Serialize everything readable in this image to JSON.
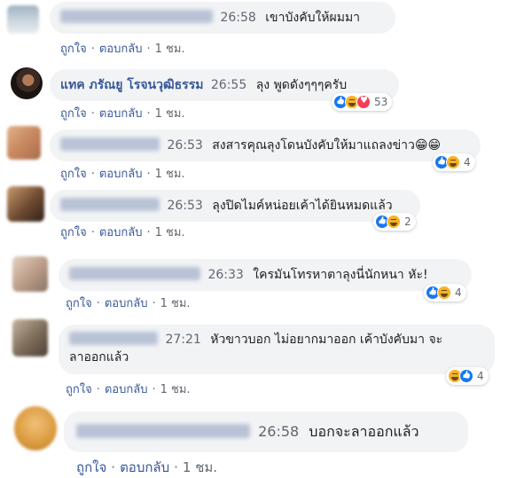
{
  "comments": [
    {
      "author": "",
      "time": "26:58",
      "text": "เขาบังคับให้ผมมา",
      "actions": {
        "like": "ถูกใจ",
        "reply": "ตอบกลับ",
        "ago": "1 ชม."
      },
      "reaction_count": "",
      "reactions": []
    },
    {
      "author": "แทค ภรัณยู โรจนวุฒิธรรม",
      "time": "26:55",
      "text": "ลุง พูดดังๆๆๆครับ",
      "actions": {
        "like": "ถูกใจ",
        "reply": "ตอบกลับ",
        "ago": "1 ชม."
      },
      "reaction_count": "53",
      "reactions": [
        "like-icon",
        "haha-icon",
        "love-icon"
      ]
    },
    {
      "author": "",
      "time": "26:53",
      "text": "สงสารคุณลุงโดนบังคับให้มาแถลงข่าว😁😁",
      "actions": {
        "like": "ถูกใจ",
        "reply": "ตอบกลับ",
        "ago": "1 ชม."
      },
      "reaction_count": "4",
      "reactions": [
        "like-icon",
        "haha-icon"
      ]
    },
    {
      "author": "",
      "time": "26:53",
      "text": "ลุงปิดไมค์หน่อยเค้าได้ยินหมดแล้ว",
      "actions": {
        "like": "ถูกใจ",
        "reply": "ตอบกลับ",
        "ago": "1 ชม."
      },
      "reaction_count": "2",
      "reactions": [
        "like-icon",
        "haha-icon"
      ]
    },
    {
      "author": "",
      "time": "26:33",
      "text": "ใครมันโทรหาตาลุงนี่นักหนา หัะ!",
      "actions": {
        "like": "ถูกใจ",
        "reply": "ตอบกลับ",
        "ago": "1 ชม."
      },
      "reaction_count": "4",
      "reactions": [
        "like-icon",
        "haha-icon"
      ]
    },
    {
      "author": "",
      "time": "27:21",
      "text": "หัวขาวบอก ไม่อยากมาออก เค้าบังคับมา จะลาออกแล้ว",
      "text_line1": "หัวขาวบอก ไม่อยากมาออก เค้าบังคับมา จะ",
      "text_line2": "ลาออกแล้ว",
      "actions": {
        "like": "ถูกใจ",
        "reply": "ตอบกลับ",
        "ago": "1 ชม."
      },
      "reaction_count": "4",
      "reactions": [
        "haha-icon",
        "like-icon"
      ]
    },
    {
      "author": "",
      "time": "26:58",
      "text": "บอกจะลาออกแล้ว",
      "actions": {
        "like": "ถูกใจ",
        "reply": "ตอบกลับ",
        "ago": "1 ชม."
      },
      "reaction_count": "",
      "reactions": []
    }
  ],
  "colors": {
    "link": "#385898",
    "meta": "#606770",
    "bubble": "#f2f3f5",
    "like": "#1877f2",
    "haha": "#f7b125",
    "love": "#f33e58"
  }
}
